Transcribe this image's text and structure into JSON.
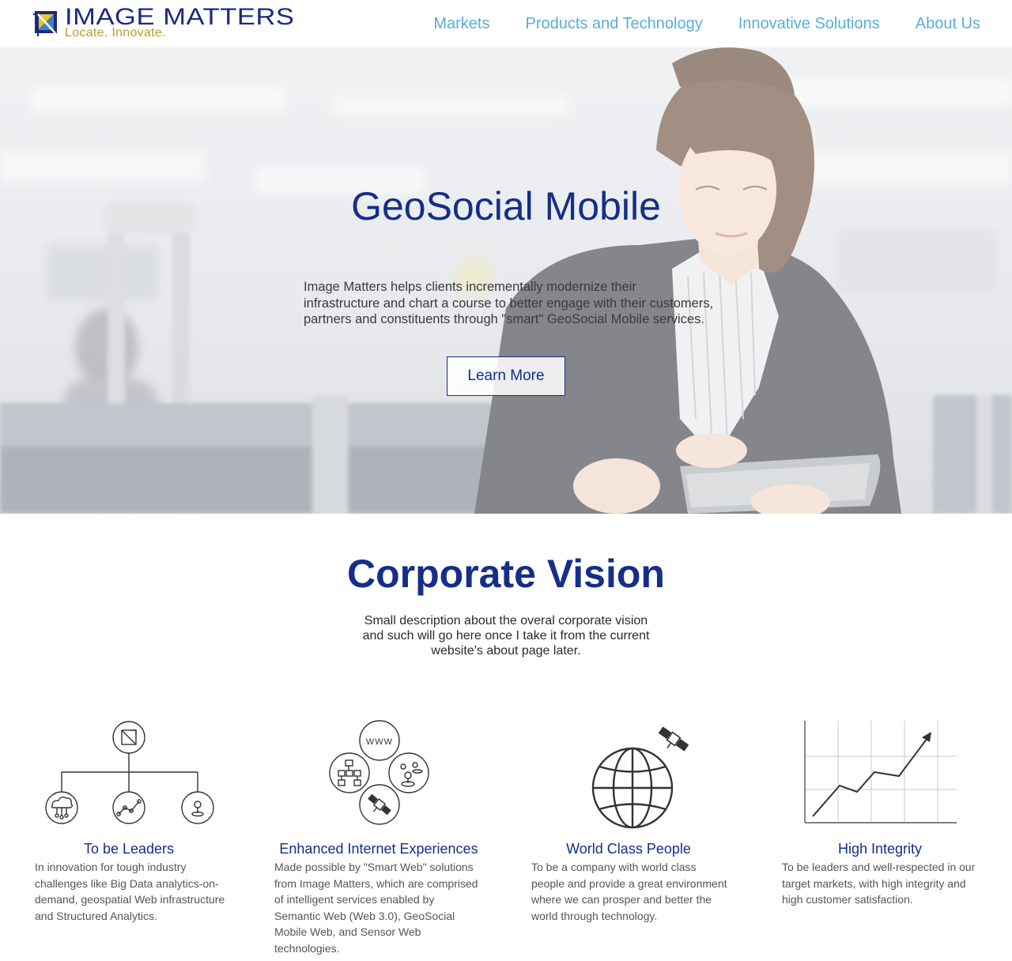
{
  "header": {
    "logo_name": "IMAGE MATTERS",
    "logo_tagline": "Locate.  Innovate.",
    "nav": [
      {
        "label": "Markets"
      },
      {
        "label": "Products and Technology"
      },
      {
        "label": "Innovative Solutions"
      },
      {
        "label": "About Us"
      }
    ]
  },
  "hero": {
    "title": "GeoSocial Mobile",
    "text": "Image Matters helps clients incrementally modernize their infrastructure and chart a course to better engage with their customers, partners and constituents through \"smart\" GeoSocial Mobile services.",
    "button_label": "Learn More"
  },
  "vision": {
    "title": "Corporate Vision",
    "text": "Small description about the overal corporate vision and such will go here once I take it from the current website’s about page later."
  },
  "features": [
    {
      "title": "To be Leaders",
      "text": "In innovation for tough industry challenges like Big Data analytics-on-demand, geospatial Web infrastructure and Structured Analytics.",
      "icon": "org-chart-icon"
    },
    {
      "title": "Enhanced Internet Experiences",
      "text": "Made possible by \"Smart Web\" solutions from Image Matters, which are comprised of intelligent services enabled by Semantic Web (Web 3.0), GeoSocial Mobile Web, and Sensor Web technologies.",
      "icon": "web-services-icon"
    },
    {
      "title": "World Class People",
      "text": "To be a company with world class people and provide a great environment where we can prosper and better the world through technology.",
      "icon": "globe-satellite-icon"
    },
    {
      "title": "High Integrity",
      "text": "To be leaders and well-respected in our target markets, with high integrity and high customer satisfaction.",
      "icon": "growth-chart-icon"
    }
  ],
  "colors": {
    "brand_blue": "#142e8a",
    "nav_blue": "#5aaed8",
    "tagline_gold": "#b8a028"
  }
}
